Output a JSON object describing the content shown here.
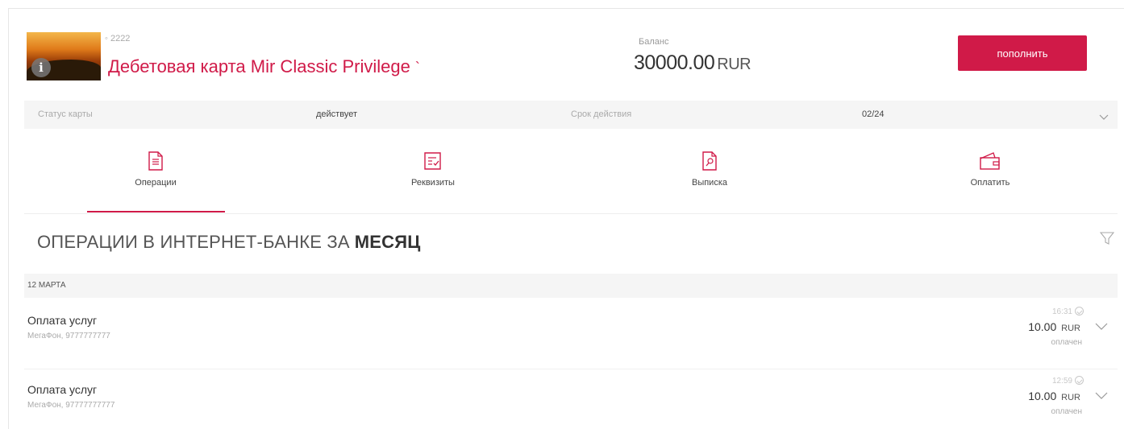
{
  "colors": {
    "accent": "#d01a48",
    "muted": "#aaaaaa",
    "panel": "#f5f5f5"
  },
  "card": {
    "number_masked": "◦ 2222",
    "title": "Дебетовая карта Mir Classic Privilege",
    "title_suffix": "`",
    "info_icon": "info-icon",
    "balance_label": "Баланс",
    "balance_value": "30000.00",
    "balance_currency": "RUR",
    "topup_label": "пополнить"
  },
  "status": {
    "status_label": "Статус карты",
    "status_value": "действует",
    "expiry_label": "Срок действия",
    "expiry_value": "02/24"
  },
  "tabs": [
    {
      "label": "Операции",
      "icon": "operations-icon",
      "active": true
    },
    {
      "label": "Реквизиты",
      "icon": "requisites-icon",
      "active": false
    },
    {
      "label": "Выписка",
      "icon": "statement-icon",
      "active": false
    },
    {
      "label": "Оплатить",
      "icon": "wallet-icon",
      "active": false
    }
  ],
  "section": {
    "title": "ОПЕРАЦИИ В ИНТЕРНЕТ-БАНКЕ ЗА",
    "period": "МЕСЯЦ",
    "date_group": "12 МАРТА"
  },
  "operations": [
    {
      "name": "Оплата услуг",
      "details": "МегаФон, 9777777777",
      "time": "16:31",
      "amount": "10.00",
      "currency": "RUR",
      "state": "оплачен"
    },
    {
      "name": "Оплата услуг",
      "details": "МегаФон, 97777777777",
      "time": "12:59",
      "amount": "10.00",
      "currency": "RUR",
      "state": "оплачен"
    }
  ]
}
